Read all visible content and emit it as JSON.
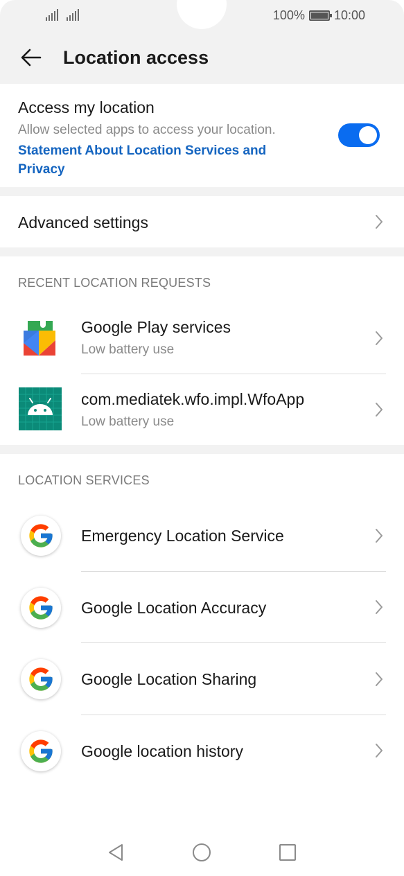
{
  "status": {
    "battery_percent": "100%",
    "time": "10:00"
  },
  "header": {
    "title": "Location access"
  },
  "access": {
    "title": "Access my location",
    "description": "Allow selected apps to access your location.",
    "link": "Statement About Location Services and Privacy",
    "toggle_on": true
  },
  "advanced": {
    "label": "Advanced settings"
  },
  "recent": {
    "heading": "RECENT LOCATION REQUESTS",
    "items": [
      {
        "label": "Google Play services",
        "sub": "Low battery use",
        "icon": "google-play-services-icon"
      },
      {
        "label": "com.mediatek.wfo.impl.WfoApp",
        "sub": "Low battery use",
        "icon": "android-app-icon"
      }
    ]
  },
  "services": {
    "heading": "LOCATION SERVICES",
    "items": [
      {
        "label": "Emergency Location Service",
        "icon": "google-g-icon"
      },
      {
        "label": "Google Location Accuracy",
        "icon": "google-g-icon"
      },
      {
        "label": "Google Location Sharing",
        "icon": "google-g-icon"
      },
      {
        "label": "Google location history",
        "icon": "google-g-icon"
      }
    ]
  },
  "colors": {
    "accent": "#0a6cf0",
    "link": "#1565c0",
    "background_grey": "#f2f2f2"
  }
}
